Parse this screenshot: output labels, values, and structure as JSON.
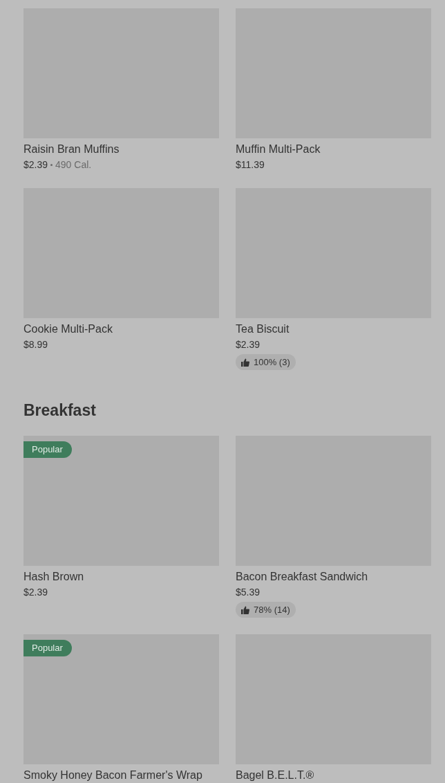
{
  "sections": [
    {
      "items": [
        {
          "name": "Raisin Bran Muffins",
          "price": "$2.39",
          "calories": "490 Cal."
        },
        {
          "name": "Muffin Multi-Pack",
          "price": "$11.39"
        },
        {
          "name": "Cookie Multi-Pack",
          "price": "$8.99"
        },
        {
          "name": "Tea Biscuit",
          "price": "$2.39",
          "rating": "100% (3)"
        }
      ]
    },
    {
      "title": "Breakfast",
      "items": [
        {
          "name": "Hash Brown",
          "price": "$2.39",
          "badge": "Popular"
        },
        {
          "name": "Bacon Breakfast Sandwich",
          "price": "$5.39",
          "rating": "78% (14)"
        },
        {
          "name": "Smoky Honey Bacon Farmer's Wrap",
          "badge": "Popular"
        },
        {
          "name": "Bagel B.E.L.T.®"
        }
      ]
    }
  ]
}
